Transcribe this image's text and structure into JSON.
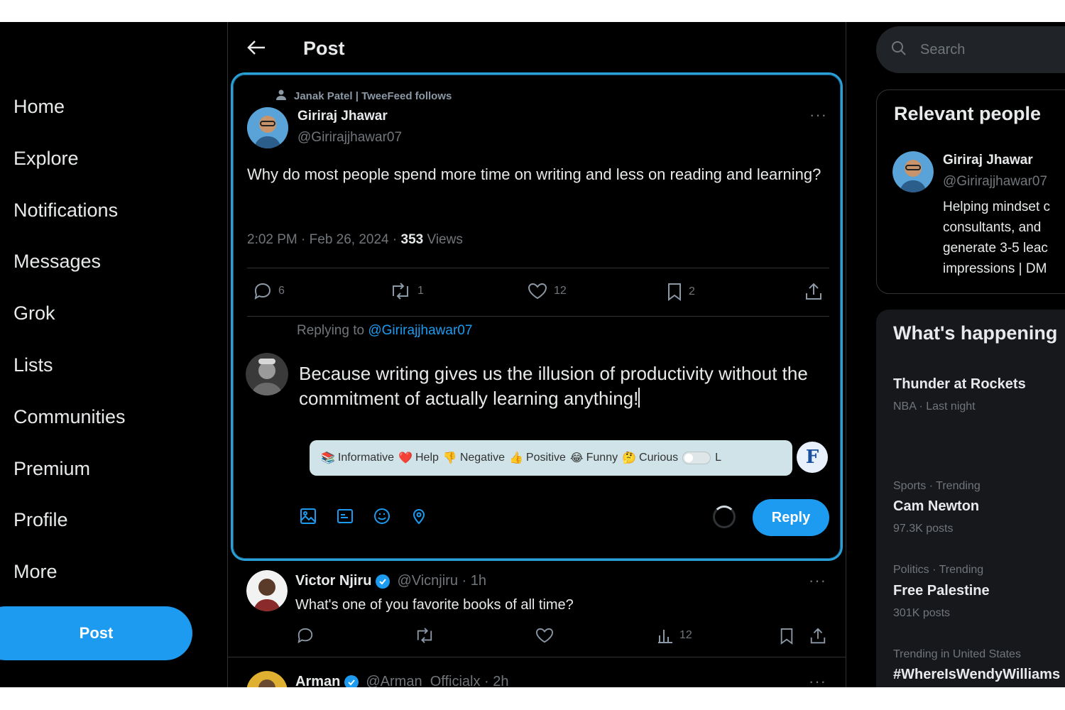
{
  "nav": {
    "items": [
      {
        "label": "Home"
      },
      {
        "label": "Explore"
      },
      {
        "label": "Notifications"
      },
      {
        "label": "Messages"
      },
      {
        "label": "Grok"
      },
      {
        "label": "Lists"
      },
      {
        "label": "Communities"
      },
      {
        "label": "Premium"
      },
      {
        "label": "Profile"
      },
      {
        "label": "More"
      }
    ],
    "post_button": "Post"
  },
  "header": {
    "title": "Post"
  },
  "main_post": {
    "social_context": "Janak Patel | TweeFeed follows",
    "author_name": "Giriraj Jhawar",
    "author_handle": "@Girirajjhawar07",
    "text": "Why do most people spend more time on writing and less on reading and learning?",
    "time": "2:02 PM · Feb 26, 2024 · ",
    "views_count": "353",
    "views_label": " Views",
    "replies": "6",
    "reposts": "1",
    "likes": "12",
    "bookmarks": "2"
  },
  "composer": {
    "replying_prefix": "Replying to ",
    "replying_to": "@Girirajjhawar07",
    "draft": "Because writing gives us the illusion of productivity without the commitment of actually learning anything!",
    "tones": [
      {
        "emoji": "📚",
        "label": "Informative"
      },
      {
        "emoji": "❤️",
        "label": "Help"
      },
      {
        "emoji": "👎",
        "label": "Negative"
      },
      {
        "emoji": "👍",
        "label": "Positive"
      },
      {
        "emoji": "😂",
        "label": "Funny"
      },
      {
        "emoji": "🤔",
        "label": "Curious"
      }
    ],
    "tone_suffix": "L",
    "logo_letter": "F",
    "reply_button": "Reply"
  },
  "feed": [
    {
      "name": "Victor Njiru",
      "handle": "@Vicnjiru · 1h",
      "text": "What's one of you favorite books of all time?",
      "views": "12"
    },
    {
      "name": "Arman",
      "handle": "@Arman_Officialx · 2h"
    }
  ],
  "search": {
    "placeholder": "Search"
  },
  "relevant": {
    "title": "Relevant people",
    "name": "Giriraj Jhawar",
    "handle": "@Girirajjhawar07",
    "bio_lines": [
      "Helping mindset c",
      "consultants, and",
      "generate 3-5 leac",
      "impressions | DM"
    ]
  },
  "happening": {
    "title": "What's happening",
    "trends": [
      {
        "context": "",
        "name": "Thunder at Rockets",
        "meta": "NBA · Last night"
      },
      {
        "context": "Sports · Trending",
        "name": "Cam Newton",
        "meta": "97.3K posts"
      },
      {
        "context": "Politics · Trending",
        "name": "Free Palestine",
        "meta": "301K posts"
      },
      {
        "context": "Trending in United States",
        "name": "#WhereIsWendyWilliams",
        "meta": ""
      }
    ]
  },
  "colors": {
    "accent": "#1d9bf0",
    "background": "#000000",
    "focus_border": "#2aa0d8"
  }
}
